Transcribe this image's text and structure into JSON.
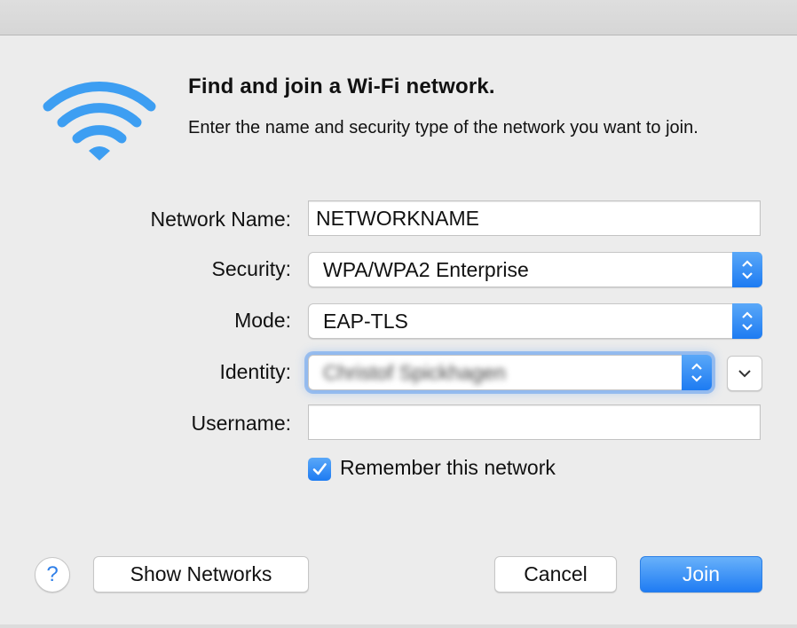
{
  "dialog": {
    "title": "Find and join a Wi-Fi network.",
    "subtitle": "Enter the name and security type of the network you want to join."
  },
  "form": {
    "network_name_label": "Network Name:",
    "network_name_value": "NETWORKNAME",
    "security_label": "Security:",
    "security_value": "WPA/WPA2 Enterprise",
    "mode_label": "Mode:",
    "mode_value": "EAP-TLS",
    "identity_label": "Identity:",
    "identity_value": "Christof Spickhagen",
    "username_label": "Username:",
    "username_value": "",
    "remember_label": "Remember this network",
    "remember_checked": true
  },
  "buttons": {
    "help": "?",
    "show_networks": "Show Networks",
    "cancel": "Cancel",
    "join": "Join"
  },
  "icons": {
    "wifi": "wifi-icon",
    "stepper": "up-down-chevron-icon",
    "disclosure": "chevron-down-icon",
    "check": "checkmark-icon"
  },
  "colors": {
    "accent": "#1f7cf3",
    "wifi": "#3d9ef2"
  }
}
